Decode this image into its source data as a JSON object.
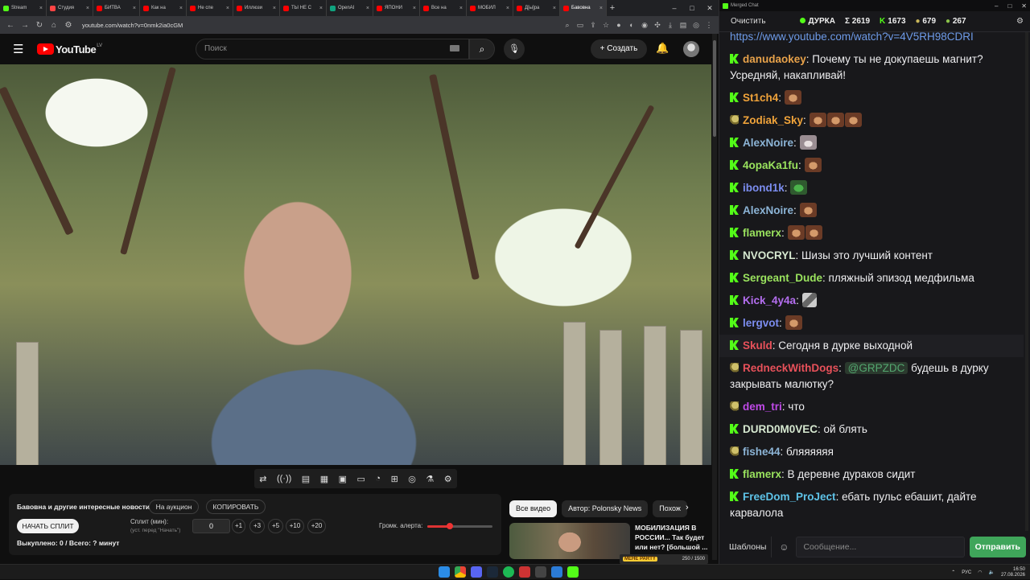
{
  "browser": {
    "tabs": [
      {
        "label": "Stream",
        "color": "#53fc18"
      },
      {
        "label": "Студия",
        "color": "#ff4444"
      },
      {
        "label": "БИТВА",
        "color": "#ff0000"
      },
      {
        "label": "Как на",
        "color": "#ff0000"
      },
      {
        "label": "Не спе",
        "color": "#ff0000"
      },
      {
        "label": "Иллюзи",
        "color": "#ff0000"
      },
      {
        "label": "ТЫ НЕ С",
        "color": "#ff0000"
      },
      {
        "label": "OpenAI",
        "color": "#10a37f"
      },
      {
        "label": "ЯПОНИ",
        "color": "#ff0000"
      },
      {
        "label": "Все на",
        "color": "#ff0000"
      },
      {
        "label": "МОБИЛ",
        "color": "#ff0000"
      },
      {
        "label": "Д[ы]ра",
        "color": "#ff0000"
      },
      {
        "label": "Бавовна",
        "color": "#ff0000"
      }
    ],
    "url": "youtube.com/watch?v=0nmk2ia0cGM"
  },
  "youtube": {
    "logo_text": "YouTube",
    "country_code": "LV",
    "search_placeholder": "Поиск",
    "create_label": "Создать"
  },
  "panel": {
    "news_label": "Бавовна и другие интересные новости",
    "auction_label": "На аукцион",
    "copy_label": "КОПИРОВАТЬ",
    "split_button": "НАЧАТЬ СПЛИТ",
    "split_label": "Сплит (мин):",
    "split_sub": "(уст. перед \"Начать\")",
    "split_value": "0",
    "increments": [
      "+1",
      "+3",
      "+5",
      "+10",
      "+20"
    ],
    "volume_label": "Громк. алерта:",
    "volume_level": 0.35,
    "bought_label": "Выкуплено: 0 / Всего: ? минут"
  },
  "recommendations": {
    "chips": [
      "Все видео",
      "Автор: Polonsky News",
      "Похож"
    ],
    "video_title": "МОБИЛИЗАЦИЯ В РОССИИ... Так будет или нет? [большой ...",
    "overlay_label": "MEHE PARTY",
    "overlay_counter": "250 / 1500"
  },
  "chat": {
    "window_title": "Merged Chat",
    "clear_label": "Очистить",
    "channel": "ДУРКА",
    "stats": {
      "total": "Σ 2619",
      "kick": "1673",
      "twitch": "679",
      "other": "267"
    },
    "messages": [
      {
        "badge": "none",
        "user": "",
        "color": "#6e9be8",
        "text": "https://www.youtube.com/watch?v=4V5RH98CDRI",
        "emotes": []
      },
      {
        "badge": "k",
        "user": "danudaokey",
        "color": "#e8a24a",
        "text": " Почему ты не докупаешь магнит? Усредняй, накапливай!",
        "emotes": []
      },
      {
        "badge": "k",
        "user": "St1ch4",
        "color": "#f0a33a",
        "text": "",
        "emotes": [
          "face"
        ]
      },
      {
        "badge": "sub",
        "user": "Zodiak_Sky",
        "color": "#f0a33a",
        "text": "",
        "emotes": [
          "face",
          "face",
          "face"
        ]
      },
      {
        "badge": "k",
        "user": "AlexNoire",
        "color": "#8cb4d6",
        "text": "",
        "emotes": [
          "cat"
        ]
      },
      {
        "badge": "k",
        "user": "4opaKa1fu",
        "color": "#9ae35e",
        "text": "",
        "emotes": [
          "face"
        ]
      },
      {
        "badge": "k",
        "user": "ibond1k",
        "color": "#7c8df0",
        "text": "",
        "emotes": [
          "pepe"
        ]
      },
      {
        "badge": "k",
        "user": "AlexNoire",
        "color": "#8cb4d6",
        "text": "",
        "emotes": [
          "face"
        ]
      },
      {
        "badge": "k",
        "user": "flamerx",
        "color": "#9ae35e",
        "text": "",
        "emotes": [
          "face",
          "face"
        ]
      },
      {
        "badge": "k",
        "user": "NVOCRYL",
        "color": "#d6e8d0",
        "text": " Шизы это лучший контент",
        "emotes": []
      },
      {
        "badge": "k",
        "user": "Sergeant_Dude",
        "color": "#9ae35e",
        "text": " пляжный эпизод медфильма",
        "emotes": []
      },
      {
        "badge": "k",
        "user": "Kick_4y4a",
        "color": "#b46ef0",
        "text": "",
        "emotes": [
          "cube"
        ]
      },
      {
        "badge": "k",
        "user": "lergvot",
        "color": "#7c8df0",
        "text": "",
        "emotes": [
          "face"
        ]
      },
      {
        "badge": "k",
        "user": "Skuld",
        "color": "#e8515a",
        "text": " Сегодня в дурке выходной",
        "emotes": [],
        "highlight": true
      },
      {
        "badge": "sub",
        "user": "RedneckWithDogs",
        "color": "#e8515a",
        "text": " будешь в дурку закрывать малютку?",
        "mention": "@GRPZDC",
        "emotes": []
      },
      {
        "badge": "sub",
        "user": "dem_tri",
        "color": "#c04ae8",
        "text": " что",
        "emotes": []
      },
      {
        "badge": "k",
        "user": "DURD0M0VEC",
        "color": "#d6e8d0",
        "text": " ой блять",
        "emotes": []
      },
      {
        "badge": "sub",
        "user": "fishe44",
        "color": "#8cb4d6",
        "text": " бляяяяяя",
        "emotes": []
      },
      {
        "badge": "k",
        "user": "flamerx",
        "color": "#9ae35e",
        "text": " В деревне дураков сидит",
        "emotes": []
      },
      {
        "badge": "k",
        "user": "FreeDom_ProJect",
        "color": "#5ec3e8",
        "text": " ебать пульс ебашит, дайте карвалола",
        "emotes": []
      }
    ],
    "templates_label": "Шаблоны",
    "input_placeholder": "Сообщение...",
    "send_label": "Отправить"
  },
  "taskbar": {
    "lang": "РУС",
    "time": "16:50",
    "date": "27.08.2026"
  }
}
